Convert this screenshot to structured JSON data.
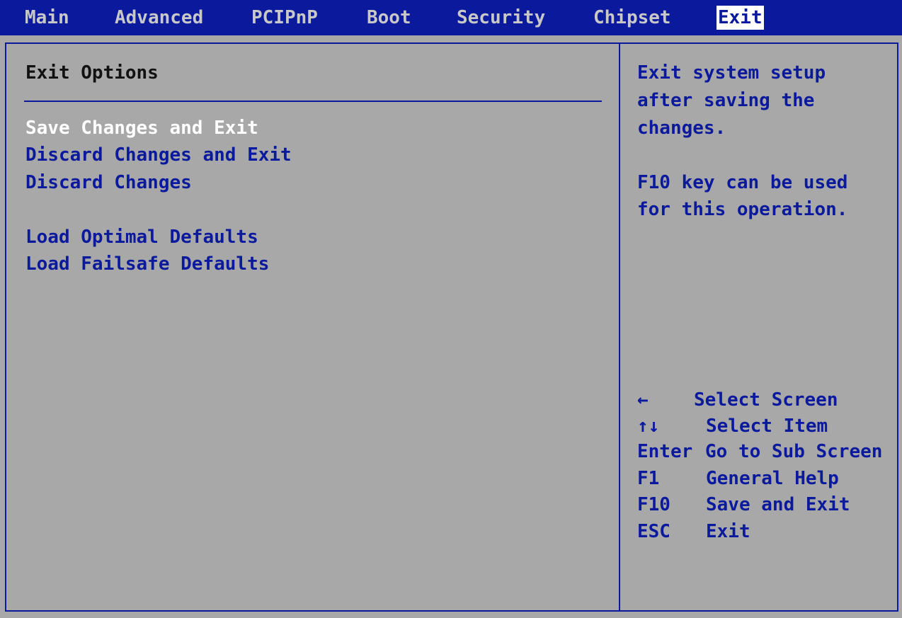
{
  "menubar": {
    "tabs": [
      {
        "label": "Main"
      },
      {
        "label": "Advanced"
      },
      {
        "label": "PCIPnP"
      },
      {
        "label": "Boot"
      },
      {
        "label": "Security"
      },
      {
        "label": "Chipset"
      },
      {
        "label": "Exit"
      }
    ],
    "active_tab": "Exit"
  },
  "main": {
    "section_title": "Exit Options",
    "options": [
      {
        "label": "Save Changes and Exit",
        "selected": true
      },
      {
        "label": "Discard Changes and Exit"
      },
      {
        "label": "Discard Changes"
      },
      {
        "label": "Load Optimal Defaults"
      },
      {
        "label": "Load Failsafe Defaults"
      }
    ]
  },
  "help": {
    "lines": [
      "Exit system setup",
      "after saving the",
      "changes.",
      "F10 key can be used",
      "for this operation."
    ]
  },
  "keys": [
    {
      "key": "←",
      "desc": "Select Screen"
    },
    {
      "key": "↑↓",
      "desc": "Select Item"
    },
    {
      "key": "Enter",
      "desc": "Go to Sub Screen"
    },
    {
      "key": "F1",
      "desc": "General Help"
    },
    {
      "key": "F10",
      "desc": "Save and Exit"
    },
    {
      "key": "ESC",
      "desc": "Exit"
    }
  ],
  "colors": {
    "accent": "#0b1a9c",
    "background": "#a8a8a8",
    "selected_text": "#ffffff"
  }
}
